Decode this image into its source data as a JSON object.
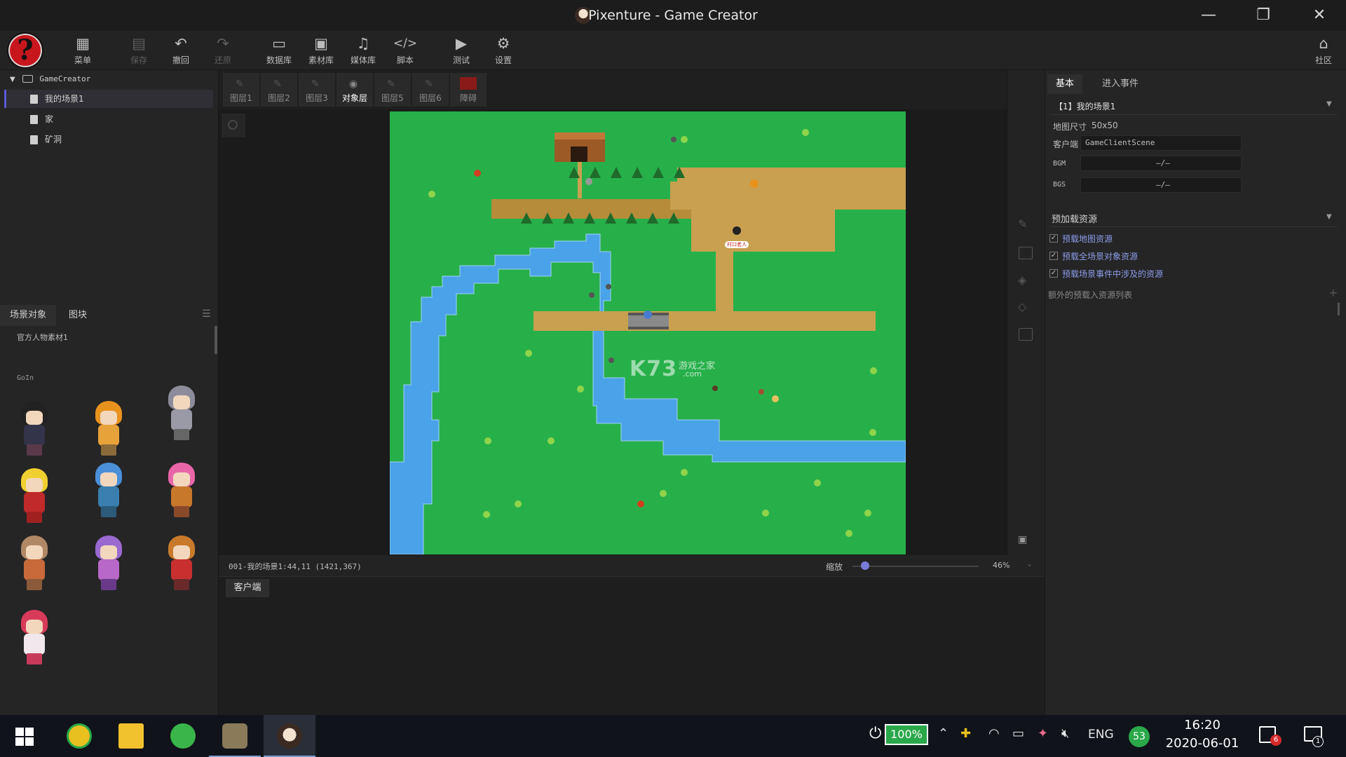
{
  "window": {
    "title": "Pixenture - Game Creator"
  },
  "toolbar": {
    "items": [
      {
        "label": "菜单",
        "icon": "grid-icon",
        "enabled": true
      },
      {
        "label": "保存",
        "icon": "save-icon",
        "enabled": false
      },
      {
        "label": "撤回",
        "icon": "undo-icon",
        "enabled": true
      },
      {
        "label": "还原",
        "icon": "redo-icon",
        "enabled": false
      },
      {
        "label": "数据库",
        "icon": "database-icon",
        "enabled": true
      },
      {
        "label": "素材库",
        "icon": "assets-icon",
        "enabled": true
      },
      {
        "label": "媒体库",
        "icon": "music-icon",
        "enabled": true
      },
      {
        "label": "脚本",
        "icon": "code-icon",
        "enabled": true
      },
      {
        "label": "测试",
        "icon": "play-icon",
        "enabled": true
      },
      {
        "label": "设置",
        "icon": "gear-icon",
        "enabled": true
      }
    ],
    "community": "社区",
    "help_glyph": "?"
  },
  "tree": {
    "root": "GameCreator",
    "scenes": [
      "我的场景1",
      "家",
      "矿洞"
    ]
  },
  "assets": {
    "tabs": [
      "场景对象",
      "图块"
    ],
    "category": "官方人物素材1",
    "group": "GoIn"
  },
  "layers": {
    "tabs": [
      "图层1",
      "图层2",
      "图层3",
      "对象层",
      "图层5",
      "图层6",
      "障碍"
    ],
    "active": "对象层"
  },
  "map": {
    "watermark": "K73",
    "watermark_sub": "游戏之家",
    "watermark_sub2": ".com",
    "npc_label": "村口老人"
  },
  "status": {
    "position": "001-我的场景1:44,11 (1421,367)",
    "zoom_label": "缩放",
    "zoom_value": "46%",
    "zoom_fraction": 0.46
  },
  "console": {
    "tab": "客户端"
  },
  "inspector": {
    "tabs": [
      "基本",
      "进入事件"
    ],
    "scene_title": "【1】我的场景1",
    "map_size_label": "地图尺寸",
    "map_size_value": "50x50",
    "client_label": "客户端",
    "client_value": "GameClientScene",
    "bgm_label": "BGM",
    "bgm_value": "—/—",
    "bgs_label": "BGS",
    "bgs_value": "—/—",
    "preload_header": "预加载资源",
    "preload_items": [
      "预载地图资源",
      "预载全场景对象资源",
      "预载场景事件中涉及的资源"
    ],
    "extra_preload": "额外的预载入资源列表"
  },
  "taskbar": {
    "battery": "100%",
    "language": "ENG",
    "badge_53": "53",
    "time": "16:20",
    "date": "2020-06-01",
    "notif_count": "6",
    "msg_count": "1"
  }
}
